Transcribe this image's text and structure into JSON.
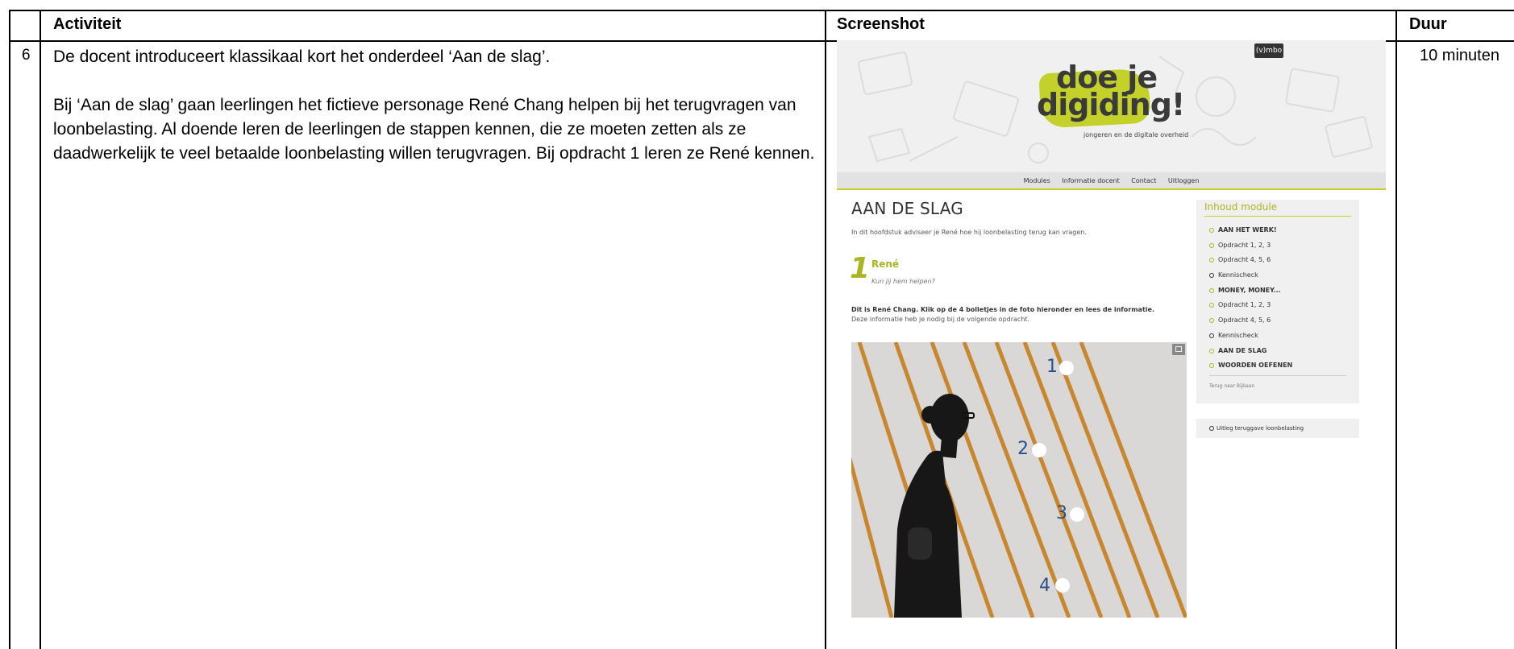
{
  "table": {
    "headers": {
      "activiteit": "Activiteit",
      "screenshot": "Screenshot",
      "duur": "Duur"
    },
    "row": {
      "number": "6",
      "paragraph1": "De docent introduceert klassikaal kort het onderdeel ‘Aan de slag’.",
      "paragraph2": "Bij ‘Aan de slag’ gaan leerlingen het fictieve personage René Chang helpen bij het terugvragen van loonbelasting. Al doende leren de leerlingen de stappen kennen, die ze moeten zetten als ze daadwerkelijk te veel betaalde loonbelasting willen terugvragen. Bij opdracht 1 leren ze René kennen.",
      "duur": "10 minuten"
    }
  },
  "screenshot": {
    "badge": "(v)mbo",
    "logo": {
      "line1": "doe je",
      "line2": "digiding!",
      "tagline": "jongeren en de digitale overheid"
    },
    "nav": [
      "Modules",
      "Informatie docent",
      "Contact",
      "Uitloggen"
    ],
    "page_title": "AAN DE SLAG",
    "intro": "In dit hoofdstuk adviseer je René hoe hij loonbelasting terug kan vragen.",
    "section": {
      "number": "1",
      "title": "René",
      "subtitle": "Kun jij hem helpen?"
    },
    "instruction_bold": "Dit is René Chang. Klik op de 4 bolletjes in de foto hieronder en lees de informatie.",
    "instruction": "Deze informatie heb je nodig bij de volgende opdracht.",
    "hotspots": [
      "1",
      "2",
      "3",
      "4"
    ],
    "sidebar": {
      "title": "Inhoud module",
      "items": [
        {
          "label": "AAN HET WERK!"
        },
        {
          "label": "Opdracht 1, 2, 3"
        },
        {
          "label": "Opdracht 4, 5, 6"
        },
        {
          "label": "Kennischeck"
        },
        {
          "label": "MONEY, MONEY..."
        },
        {
          "label": "Opdracht 1, 2, 3"
        },
        {
          "label": "Opdracht 4, 5, 6"
        },
        {
          "label": "Kennischeck"
        },
        {
          "label": "AAN DE SLAG"
        },
        {
          "label": "WOORDEN OEFENEN"
        }
      ],
      "back_link": "Terug naar Bijbaan"
    },
    "uitleg_link": "Uitleg teruggave loonbelasting",
    "colors": {
      "accent": "#c3d12a",
      "accent_text": "#a9b523",
      "hotspot_number": "#2c4f8a"
    }
  }
}
